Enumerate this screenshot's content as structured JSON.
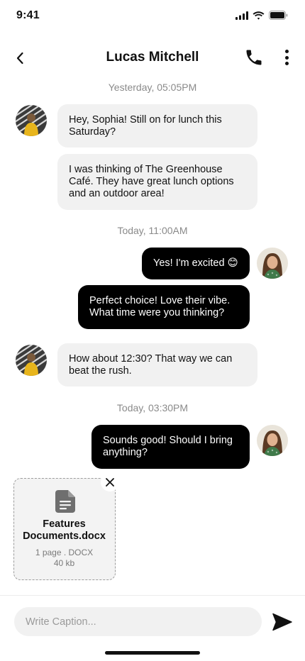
{
  "status_bar": {
    "time": "9:41"
  },
  "header": {
    "contact_name": "Lucas Mitchell"
  },
  "timestamps": [
    "Yesterday, 05:05PM",
    "Today, 11:00AM",
    "Today, 03:30PM"
  ],
  "messages": [
    {
      "sender": "incoming",
      "text": "Hey, Sophia! Still on for lunch this Saturday?"
    },
    {
      "sender": "incoming",
      "text": "I was thinking of The Greenhouse Café. They have great lunch options and an outdoor area!"
    },
    {
      "sender": "outgoing",
      "text": "Yes! I'm excited 😊"
    },
    {
      "sender": "outgoing",
      "text": "Perfect choice! Love their vibe. What time were you thinking?"
    },
    {
      "sender": "incoming",
      "text": "How about 12:30? That way we can beat the rush."
    },
    {
      "sender": "outgoing",
      "text": "Sounds good! Should I bring anything?"
    }
  ],
  "attachment": {
    "name": "Features Documents.docx",
    "pages": "1 page . DOCX",
    "size": "40 kb",
    "icon": "document-icon"
  },
  "composer": {
    "placeholder": "Write Caption..."
  },
  "colors": {
    "incoming_bubble": "#f1f1f1",
    "outgoing_bubble": "#000000",
    "timestamp": "#8a8a8a"
  }
}
